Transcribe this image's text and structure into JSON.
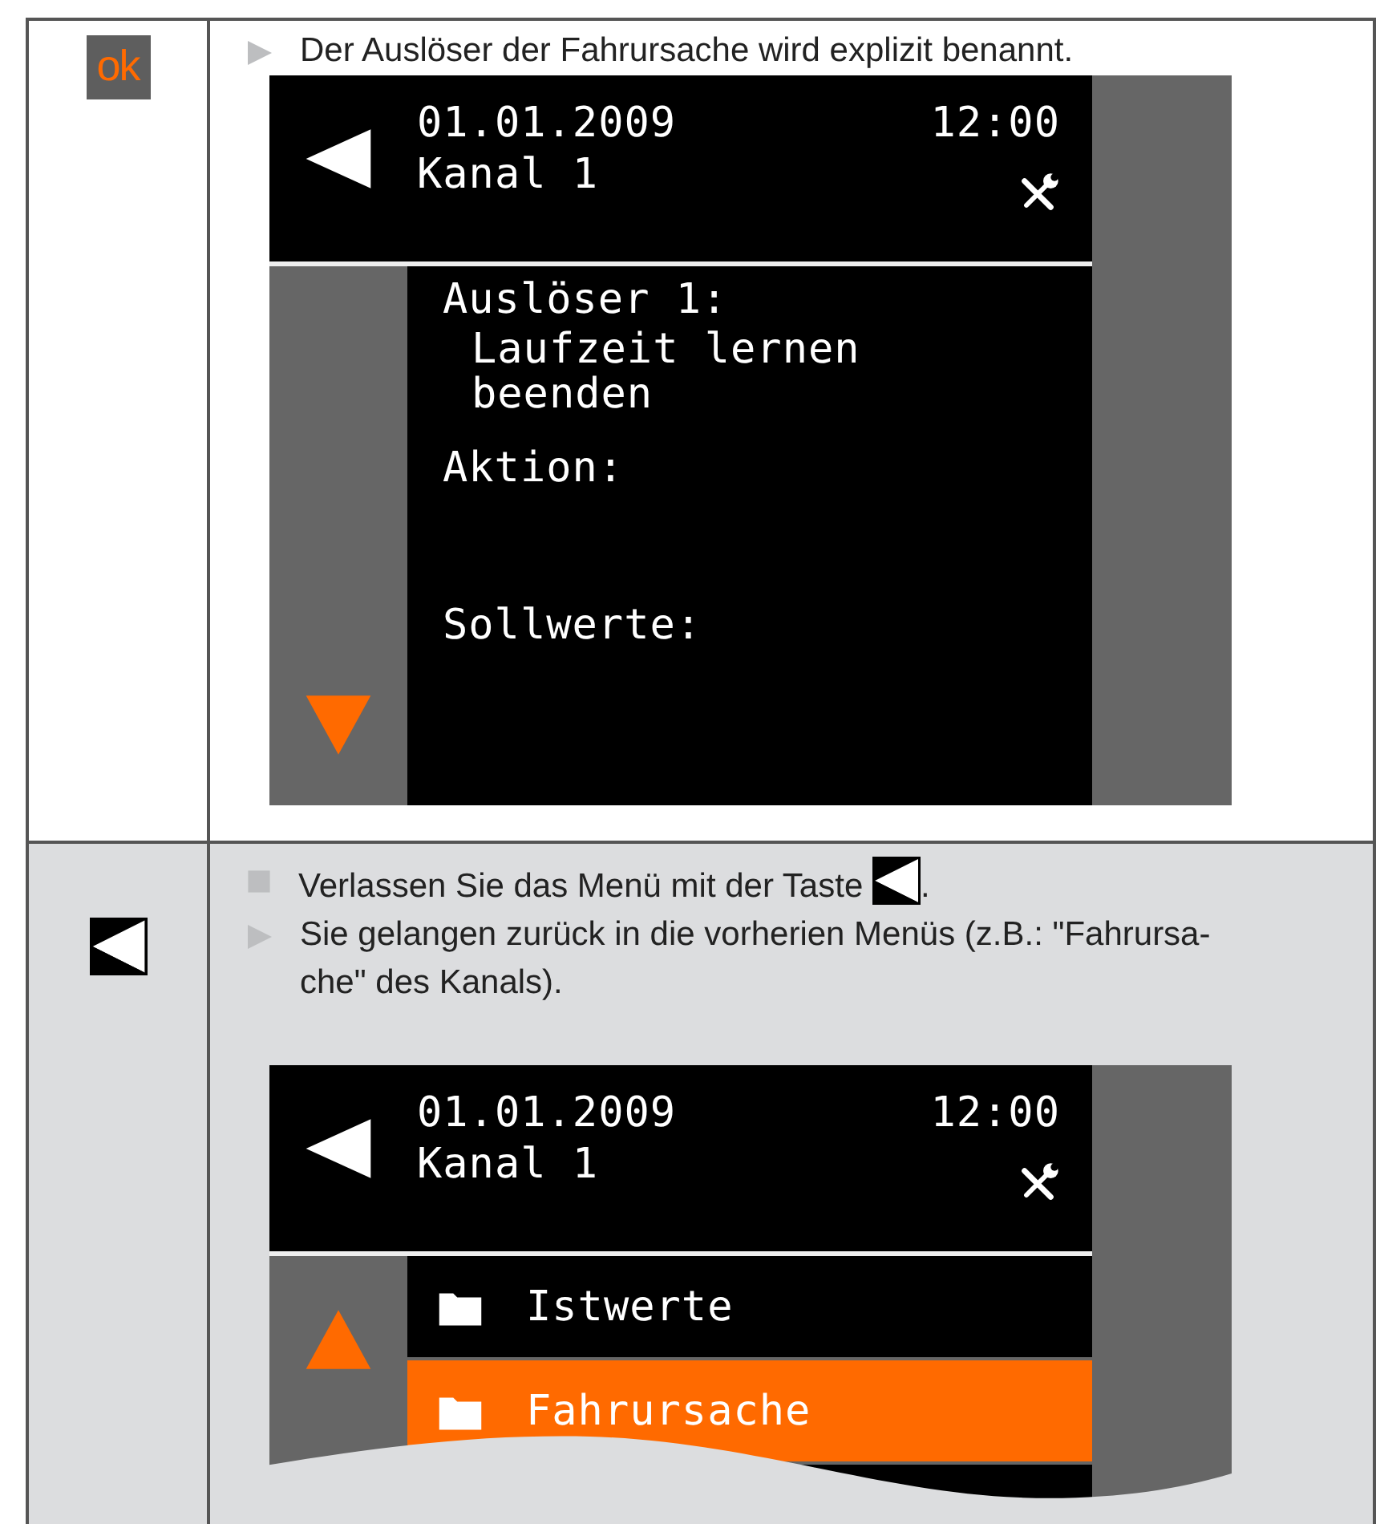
{
  "rows": [
    {
      "key": {
        "kind": "ok",
        "label": "ok"
      },
      "shaded": false,
      "lines": [
        {
          "kind": "result",
          "text_lines": [
            "Der Auslöser der Fahrursache wird explizit benannt."
          ]
        }
      ],
      "screen": {
        "kind": "detail",
        "date": "01.01.2009",
        "time": "12:00",
        "channel": "Kanal 1",
        "scroll_up": false,
        "scroll_down": true,
        "sections": [
          {
            "label": "Auslöser 1:",
            "values": [
              "Laufzeit lernen",
              "beenden"
            ]
          },
          {
            "label": "Aktion:"
          },
          {
            "label": "Sollwerte:"
          }
        ]
      }
    },
    {
      "key": {
        "kind": "back"
      },
      "shaded": true,
      "lines": [
        {
          "kind": "action",
          "text_lines": [
            "Verlassen Sie das Menü mit der Taste"
          ],
          "key_icon_inline": true,
          "after": "."
        },
        {
          "kind": "result",
          "text_lines": [
            "Sie gelangen zurück in die vorherien Menüs (z.B.: \"Fahrursa-",
            "che\" des Kanals)."
          ]
        }
      ],
      "screen": {
        "kind": "menu",
        "date": "01.01.2009",
        "time": "12:00",
        "channel": "Kanal 1",
        "scroll_up": true,
        "scroll_down": false,
        "torn": true,
        "items": [
          {
            "label": "Istwerte",
            "selected": false
          },
          {
            "label": "Fahrursache",
            "selected": true
          }
        ]
      }
    }
  ]
}
